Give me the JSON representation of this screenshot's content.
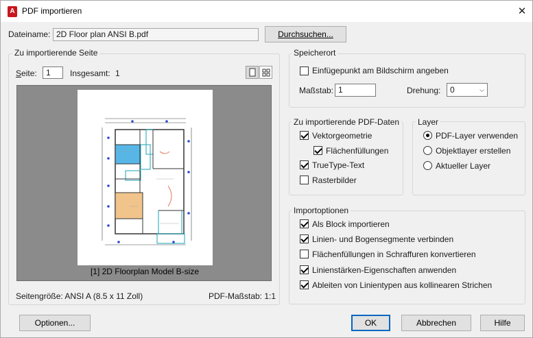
{
  "window": {
    "title": "PDF importieren",
    "app_icon_letter": "A"
  },
  "file": {
    "label": "Dateiname:",
    "value": "2D Floor plan ANSI B.pdf",
    "browse_button": "Durchsuchen..."
  },
  "page_group": {
    "title": "Zu importierende Seite",
    "page_label": "Seite:",
    "page_value": "1",
    "total_label": "Insgesamt:",
    "total_value": "1",
    "preview_caption": "[1] 2D Floorplan Model B-size",
    "page_size": "Seitengröße:  ANSI A (8.5 x 11 Zoll)",
    "pdf_scale": "PDF-Maßstab:  1:1"
  },
  "location": {
    "title": "Speicherort",
    "insert_point_label": "Einfügepunkt am Bildschirm angeben",
    "insert_point_checked": false,
    "scale_label": "Maßstab:",
    "scale_value": "1",
    "rotation_label": "Drehung:",
    "rotation_value": "0"
  },
  "pdf_data": {
    "title": "Zu importierende PDF-Daten",
    "items": [
      {
        "label": "Vektorgeometrie",
        "checked": true
      },
      {
        "label": "Flächenfüllungen",
        "checked": true
      },
      {
        "label": "TrueType-Text",
        "checked": true
      },
      {
        "label": "Rasterbilder",
        "checked": false
      }
    ]
  },
  "layer": {
    "title": "Layer",
    "options": [
      {
        "label": "PDF-Layer verwenden",
        "selected": true
      },
      {
        "label": "Objektlayer erstellen",
        "selected": false
      },
      {
        "label": "Aktueller Layer",
        "selected": false
      }
    ]
  },
  "import_options": {
    "title": "Importoptionen",
    "items": [
      {
        "label": "Als Block importieren",
        "checked": true
      },
      {
        "label": "Linien- und Bogensegmente verbinden",
        "checked": true
      },
      {
        "label": "Flächenfüllungen in Schraffuren konvertieren",
        "checked": false
      },
      {
        "label": "Linienstärken-Eigenschaften anwenden",
        "checked": true
      },
      {
        "label": "Ableiten von Linientypen aus kollinearen Strichen",
        "checked": true
      }
    ]
  },
  "buttons": {
    "options": "Optionen...",
    "ok": "OK",
    "cancel": "Abbrechen",
    "help": "Hilfe"
  },
  "colors": {
    "app_icon": "#c8161d",
    "preview_bg": "#8b8b8b",
    "default_button_border": "#0067c0"
  }
}
